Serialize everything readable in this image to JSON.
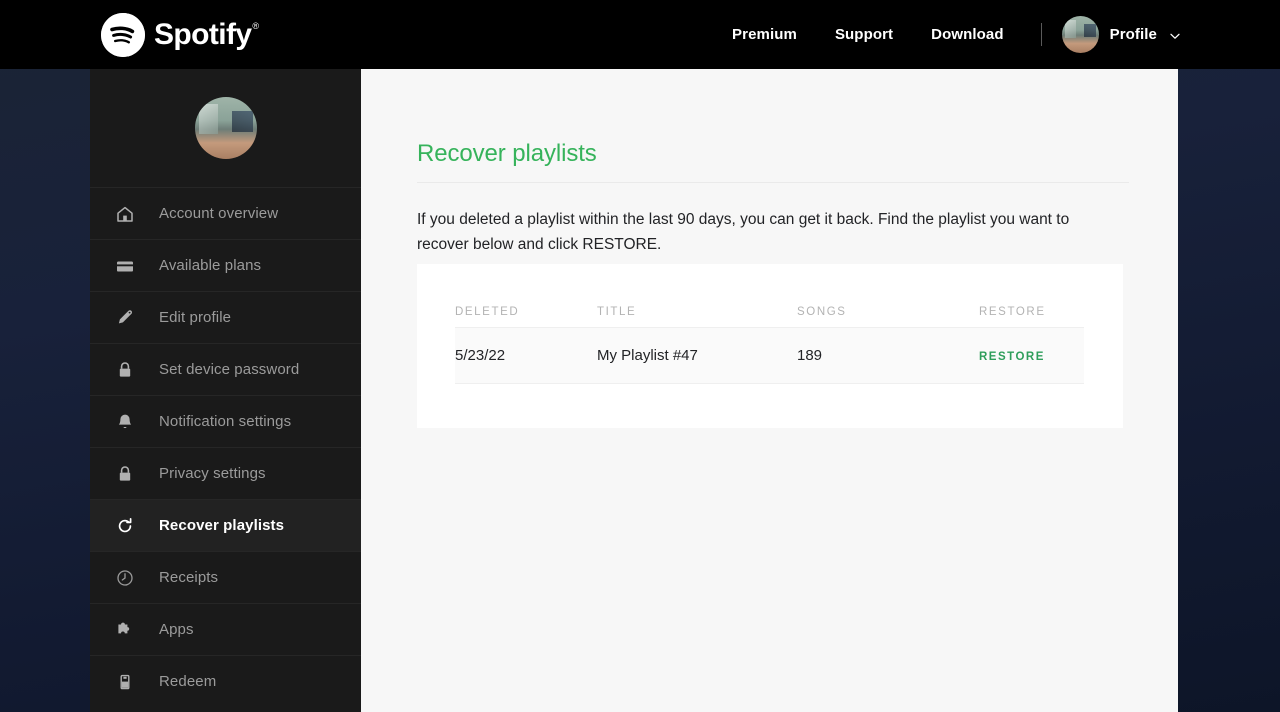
{
  "brand": {
    "name": "Spotify",
    "registered_mark": "®",
    "logo_icon": "spotify-logo-icon"
  },
  "topnav": {
    "links": [
      {
        "label": "Premium"
      },
      {
        "label": "Support"
      },
      {
        "label": "Download"
      }
    ],
    "separator": "|",
    "profile": {
      "label": "Profile",
      "avatar_icon": "user-avatar-photo",
      "chevron_icon": "chevron-down-icon"
    }
  },
  "sidebar": {
    "avatar_icon": "user-avatar-photo-large",
    "items": [
      {
        "label": "Account overview",
        "icon": "home-icon",
        "active": false
      },
      {
        "label": "Available plans",
        "icon": "credit-card-icon",
        "active": false
      },
      {
        "label": "Edit profile",
        "icon": "pencil-icon",
        "active": false
      },
      {
        "label": "Set device password",
        "icon": "lock-icon",
        "active": false
      },
      {
        "label": "Notification settings",
        "icon": "bell-icon",
        "active": false
      },
      {
        "label": "Privacy settings",
        "icon": "lock-icon",
        "active": false
      },
      {
        "label": "Recover playlists",
        "icon": "refresh-circle-icon",
        "active": true
      },
      {
        "label": "Receipts",
        "icon": "clock-icon",
        "active": false
      },
      {
        "label": "Apps",
        "icon": "puzzle-piece-icon",
        "active": false
      },
      {
        "label": "Redeem",
        "icon": "gift-card-icon",
        "active": false
      }
    ]
  },
  "main": {
    "title": "Recover playlists",
    "intro": "If you deleted a playlist within the last 90 days, you can get it back. Find the playlist you want to recover below and click RESTORE.",
    "table": {
      "columns": [
        "DELETED",
        "TITLE",
        "SONGS",
        "RESTORE"
      ],
      "rows": [
        {
          "deleted": "5/23/22",
          "title": "My Playlist #47",
          "songs": "189",
          "restore_label": "RESTORE"
        }
      ]
    }
  },
  "colors": {
    "brand_green": "#1ed760",
    "title_green": "#36b35b",
    "restore_green": "#2f9e5b",
    "topbar_black": "#000000",
    "sidebar_dark": "#1a1a1a",
    "sidebar_active": "#222222",
    "content_bg": "#f7f7f7",
    "card_bg": "#ffffff",
    "page_bg_navy": "#18213a"
  }
}
